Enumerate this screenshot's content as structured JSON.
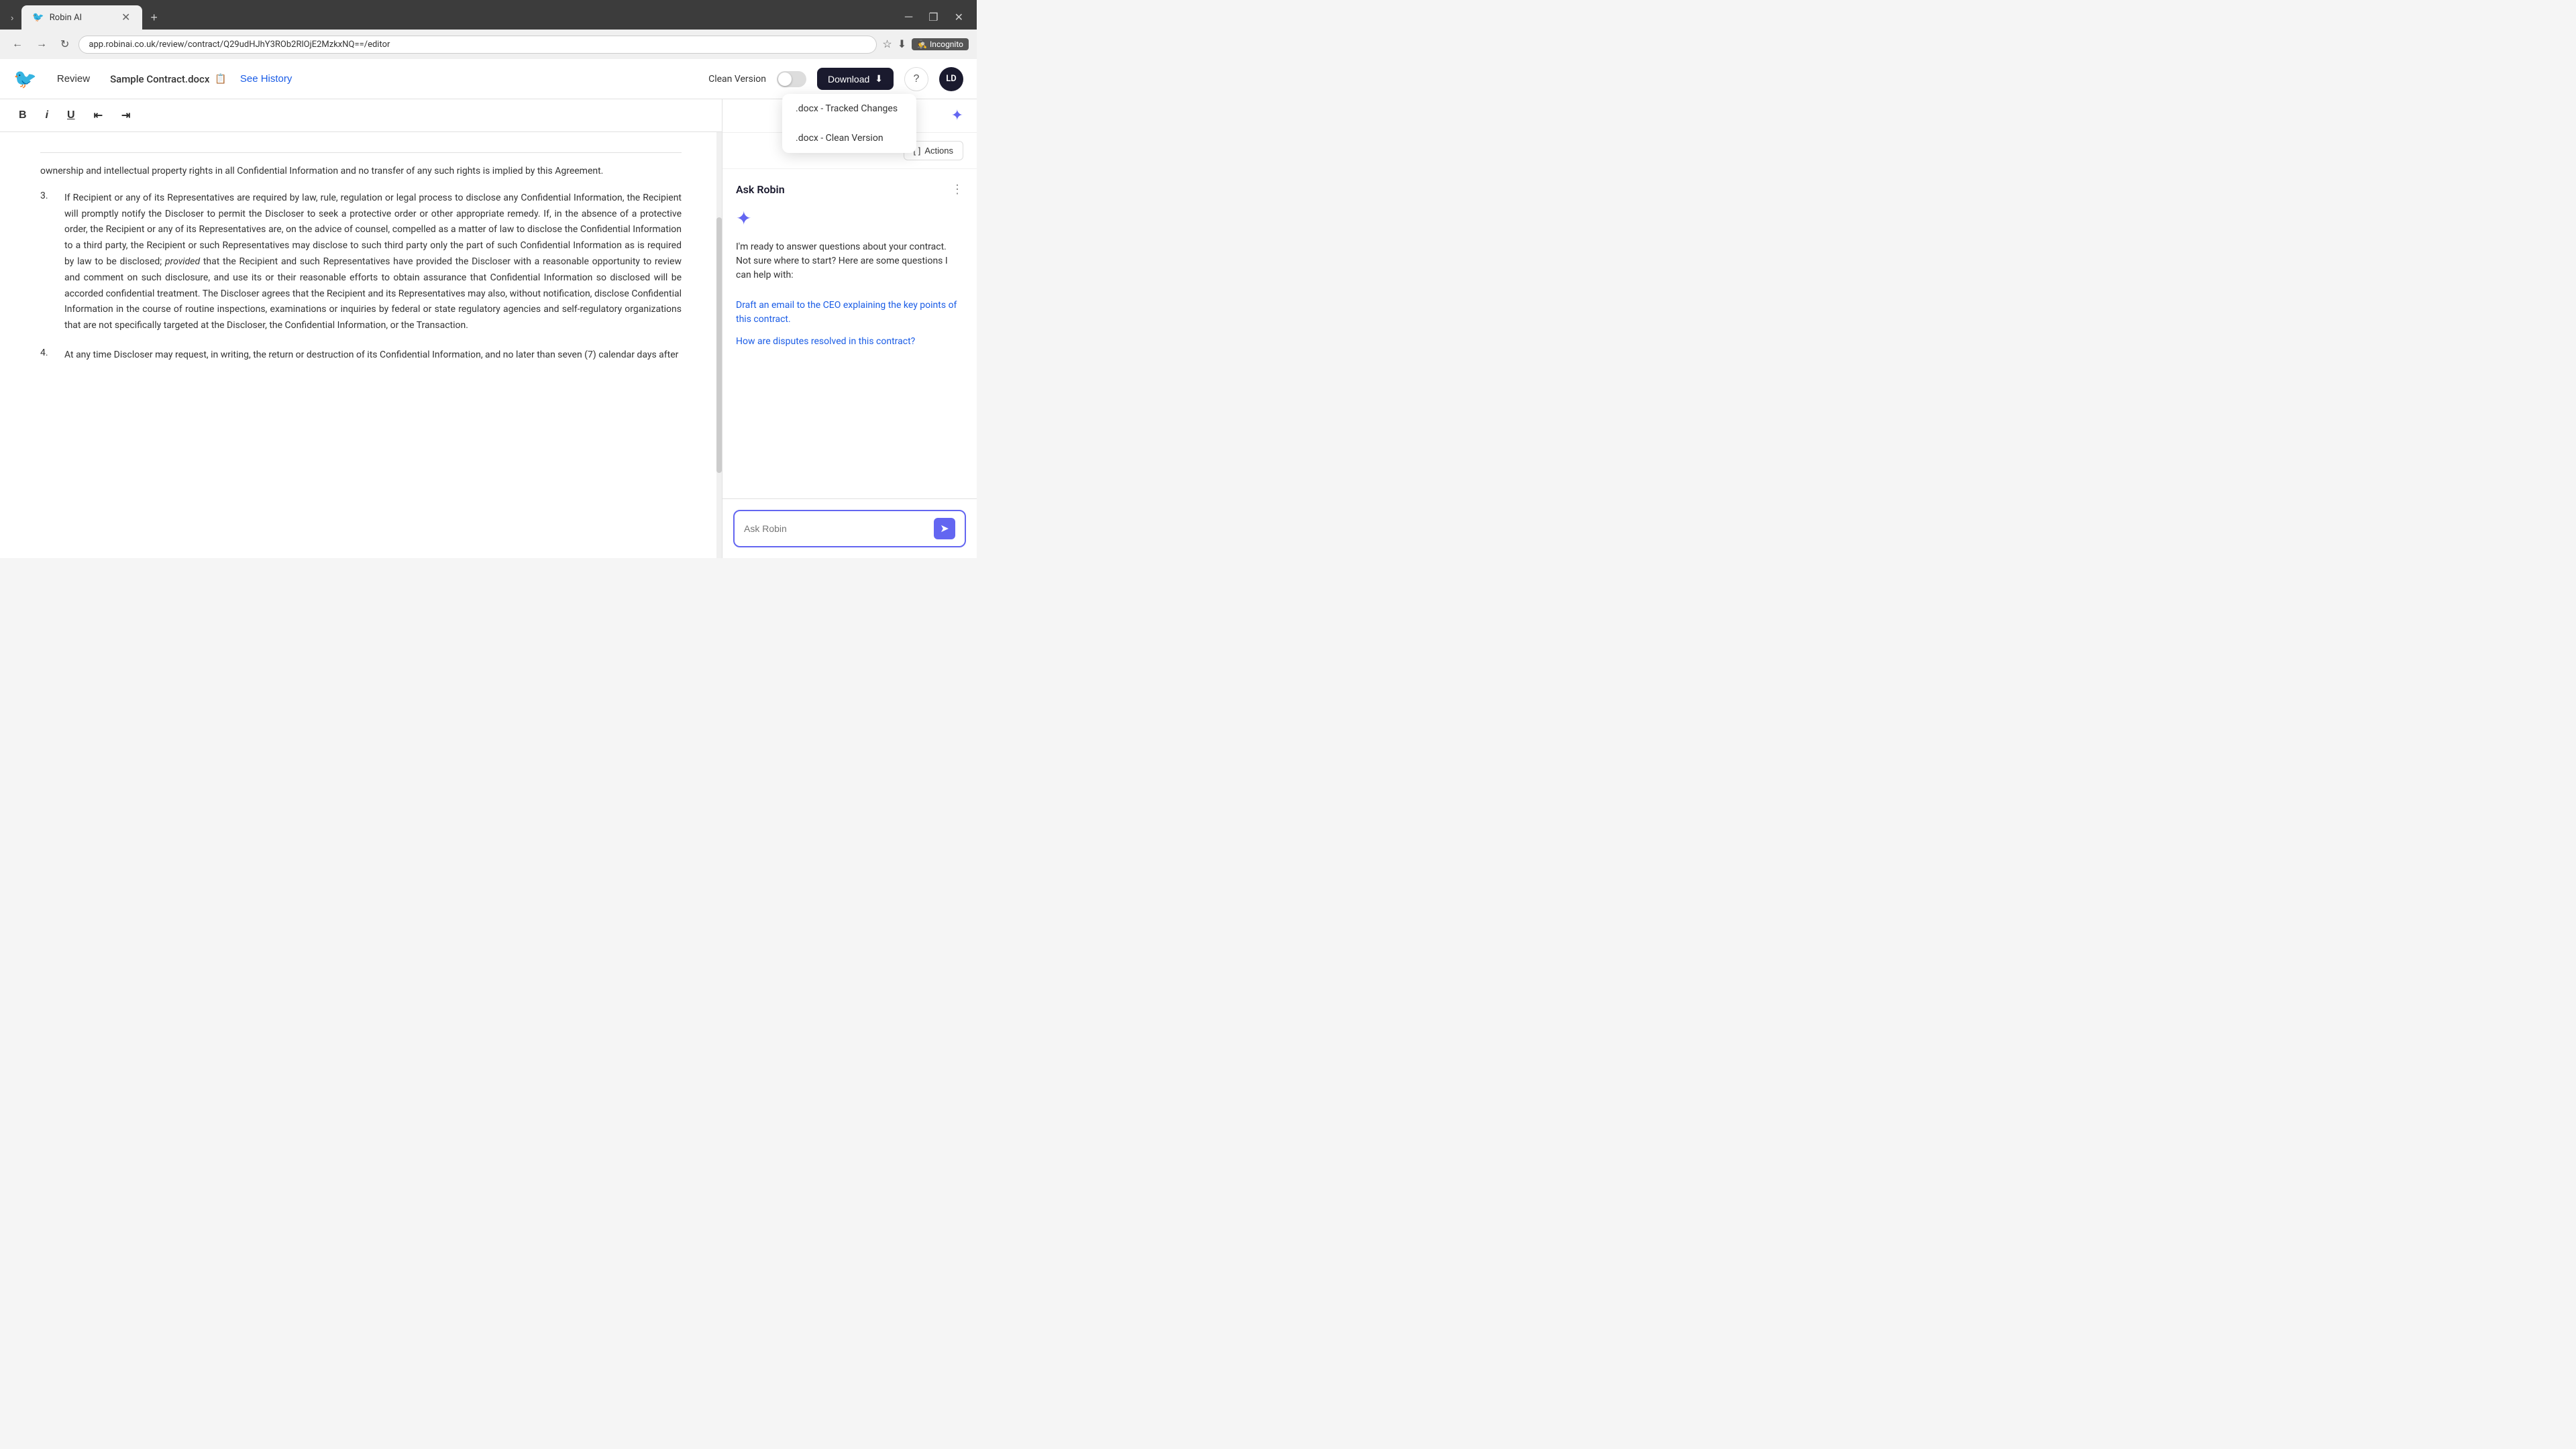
{
  "browser": {
    "tab_title": "Robin AI",
    "url": "app.robinai.co.uk/review/contract/Q29udHJhY3ROb2RlOjE2MzkxNQ==/editor",
    "incognito_label": "Incognito"
  },
  "header": {
    "review_label": "Review",
    "doc_title": "Sample Contract.docx",
    "see_history_label": "See History",
    "clean_version_label": "Clean Version",
    "download_label": "Download",
    "help_label": "?",
    "avatar_label": "LD"
  },
  "dropdown": {
    "items": [
      ".docx - Tracked Changes",
      ".docx - Clean Version"
    ]
  },
  "toolbar": {
    "bold": "B",
    "italic": "i",
    "underline": "U",
    "indent_left": "⇤",
    "indent_right": "⇥"
  },
  "content": {
    "intro_text": "ownership and intellectual property rights in all Confidential Information and no transfer of any such rights is implied by this Agreement.",
    "items": [
      {
        "num": "3.",
        "text": "If Recipient or any of its Representatives are required by law, rule, regulation or legal process to disclose any Confidential Information, the Recipient will promptly notify the Discloser to permit the Discloser to seek a protective order or other appropriate remedy. If, in the absence of a protective order, the Recipient or any of its Representatives are, on the advice of counsel, compelled as a matter of law to disclose the Confidential Information to a third party, the Recipient or such Representatives may disclose to such third party only the part of such Confidential Information as is required by law to be disclosed;",
        "italic_word": "provided",
        "text_after": "that the Recipient and such Representatives have provided the Discloser with a reasonable opportunity to review and comment on such disclosure, and use its or their reasonable efforts to obtain assurance that Confidential Information so disclosed will be accorded confidential treatment. The Discloser agrees that the Recipient and its Representatives may also, without notification, disclose Confidential Information in the course of routine inspections, examinations or inquiries by federal or state regulatory agencies and self-regulatory organizations that are not specifically targeted at the Discloser, the Confidential Information, or the Transaction."
      },
      {
        "num": "4.",
        "text": "At any time Discloser may request, in writing, the return or destruction of its Confidential Information, and no later than seven (7) calendar days after"
      }
    ]
  },
  "sidebar": {
    "ask_robin_title": "Ask Robin",
    "actions_label": "Actions",
    "bracket_icon": "[ ]",
    "robin_intro_line1": "I'm ready to answer questions about your contract.",
    "robin_intro_line2": "Not sure where to start? Here are some questions I can help with:",
    "suggestions": [
      "Draft an email to the CEO explaining the key points of this contract.",
      "How are disputes resolved in this contract?"
    ],
    "input_placeholder": "Ask Robin"
  }
}
